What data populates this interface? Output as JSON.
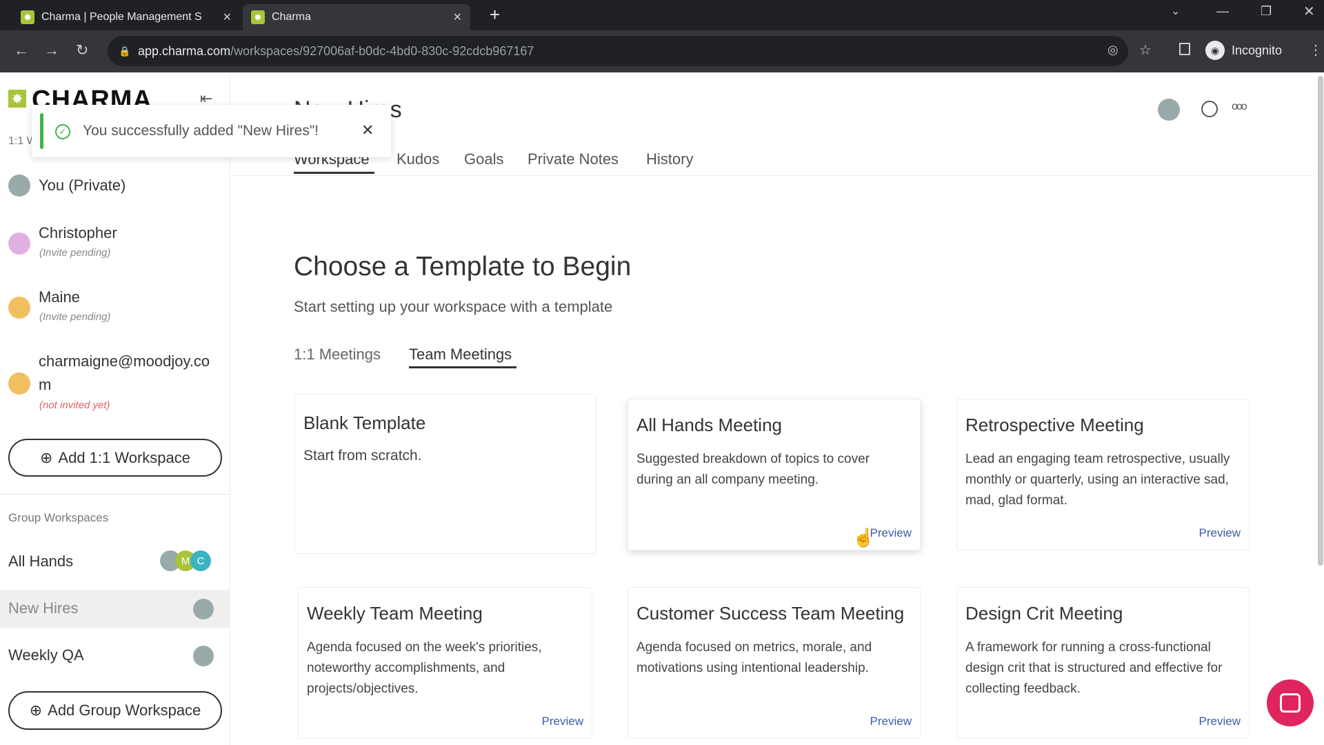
{
  "browser": {
    "tabs": [
      {
        "title": "Charma | People Management S"
      },
      {
        "title": "Charma"
      }
    ],
    "url_host": "app.charma.com",
    "url_path": "/workspaces/927006af-b0dc-4bd0-830c-92cdcb967167",
    "profile": "Incognito"
  },
  "sidebar": {
    "logo": "CHARMA",
    "section_1on1": "1:1 Workspaces",
    "people": [
      {
        "name": "You (Private)",
        "sub": ""
      },
      {
        "name": "Christopher",
        "sub": "(Invite pending)"
      },
      {
        "name": "Maine",
        "sub": "(Invite pending)"
      },
      {
        "name": "charmaigne@moodjoy.co",
        "name2": "m",
        "sub": "(not invited yet)"
      }
    ],
    "add_1on1": "Add 1:1 Workspace",
    "group_header": "Group Workspaces",
    "groups": [
      {
        "name": "All Hands",
        "badges": [
          "M",
          "C"
        ]
      },
      {
        "name": "New Hires"
      },
      {
        "name": "Weekly QA"
      }
    ],
    "add_group": "Add Group Workspace"
  },
  "toast": {
    "message": "You successfully added \"New Hires\"!"
  },
  "header": {
    "title": "New Hires",
    "tabs": [
      "Workspace",
      "Kudos",
      "Goals",
      "Private Notes",
      "History"
    ],
    "active_tab": "Workspace"
  },
  "main": {
    "heading": "Choose a Template to Begin",
    "subheading": "Start setting up your workspace with a template",
    "template_tabs": [
      "1:1 Meetings",
      "Team Meetings"
    ],
    "active_template_tab": "Team Meetings",
    "preview_label": "Preview",
    "cards": [
      {
        "title": "Blank Template",
        "desc": "Start from scratch."
      },
      {
        "title": "All Hands Meeting",
        "desc": "Suggested breakdown of topics to cover during an all company meeting."
      },
      {
        "title": "Retrospective Meeting",
        "desc": "Lead an engaging team retrospective, usually monthly or quarterly, using an interactive sad, mad, glad format."
      },
      {
        "title": "Weekly Team Meeting",
        "desc": "Agenda focused on the week's priorities, noteworthy accomplishments, and projects/objectives."
      },
      {
        "title": "Customer Success Team Meeting",
        "desc": "Agenda focused on metrics, morale, and motivations using intentional leadership."
      },
      {
        "title": "Design Crit Meeting",
        "desc": "A framework for running a cross-functional design crit that is structured and effective for collecting feedback."
      }
    ]
  },
  "colors": {
    "brand": "#a8c43a",
    "success": "#3cb54a",
    "link": "#3a5da8",
    "chat": "#e0245e"
  }
}
